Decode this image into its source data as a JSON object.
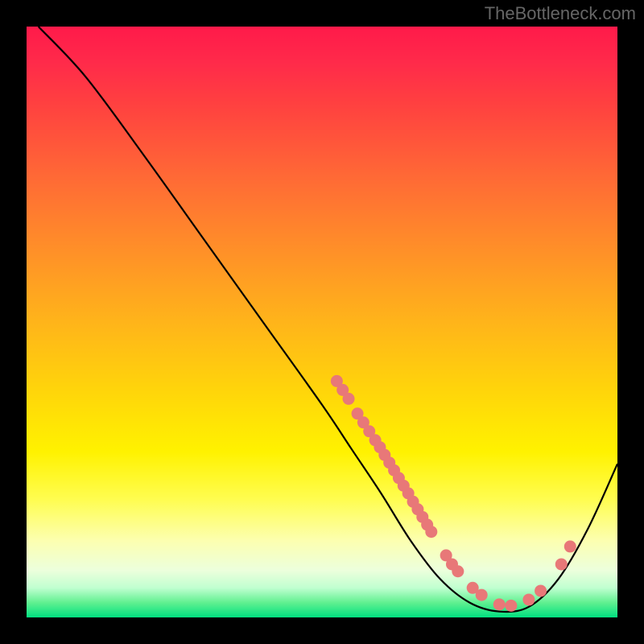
{
  "attribution": "TheBottleneck.com",
  "chart_data": {
    "type": "line",
    "title": "",
    "xlabel": "",
    "ylabel": "",
    "xlim": [
      0,
      100
    ],
    "ylim": [
      0,
      100
    ],
    "curve": [
      {
        "x": 2.0,
        "y": 100.0
      },
      {
        "x": 10.0,
        "y": 91.5
      },
      {
        "x": 20.0,
        "y": 78.0
      },
      {
        "x": 30.0,
        "y": 64.0
      },
      {
        "x": 40.0,
        "y": 50.0
      },
      {
        "x": 50.0,
        "y": 36.0
      },
      {
        "x": 55.0,
        "y": 28.5
      },
      {
        "x": 60.0,
        "y": 21.0
      },
      {
        "x": 65.0,
        "y": 13.0
      },
      {
        "x": 70.0,
        "y": 6.5
      },
      {
        "x": 75.0,
        "y": 2.5
      },
      {
        "x": 80.0,
        "y": 1.0
      },
      {
        "x": 85.0,
        "y": 1.8
      },
      {
        "x": 90.0,
        "y": 6.5
      },
      {
        "x": 95.0,
        "y": 15.0
      },
      {
        "x": 100.0,
        "y": 26.0
      }
    ],
    "highlight_points": [
      {
        "x": 52.5,
        "y": 40.0
      },
      {
        "x": 53.5,
        "y": 38.5
      },
      {
        "x": 54.5,
        "y": 37.0
      },
      {
        "x": 56.0,
        "y": 34.5
      },
      {
        "x": 57.0,
        "y": 33.0
      },
      {
        "x": 58.0,
        "y": 31.5
      },
      {
        "x": 59.0,
        "y": 30.0
      },
      {
        "x": 59.8,
        "y": 28.8
      },
      {
        "x": 60.6,
        "y": 27.5
      },
      {
        "x": 61.4,
        "y": 26.2
      },
      {
        "x": 62.2,
        "y": 24.9
      },
      {
        "x": 63.0,
        "y": 23.6
      },
      {
        "x": 63.8,
        "y": 22.3
      },
      {
        "x": 64.6,
        "y": 21.0
      },
      {
        "x": 65.4,
        "y": 19.6
      },
      {
        "x": 66.2,
        "y": 18.3
      },
      {
        "x": 67.0,
        "y": 17.0
      },
      {
        "x": 67.8,
        "y": 15.7
      },
      {
        "x": 68.5,
        "y": 14.5
      },
      {
        "x": 71.0,
        "y": 10.5
      },
      {
        "x": 72.0,
        "y": 9.0
      },
      {
        "x": 73.0,
        "y": 7.8
      },
      {
        "x": 75.5,
        "y": 5.0
      },
      {
        "x": 77.0,
        "y": 3.8
      },
      {
        "x": 80.0,
        "y": 2.2
      },
      {
        "x": 82.0,
        "y": 2.0
      },
      {
        "x": 85.0,
        "y": 3.0
      },
      {
        "x": 87.0,
        "y": 4.5
      },
      {
        "x": 90.5,
        "y": 9.0
      },
      {
        "x": 92.0,
        "y": 12.0
      }
    ],
    "point_color": "#e87878",
    "curve_color": "#000000"
  }
}
